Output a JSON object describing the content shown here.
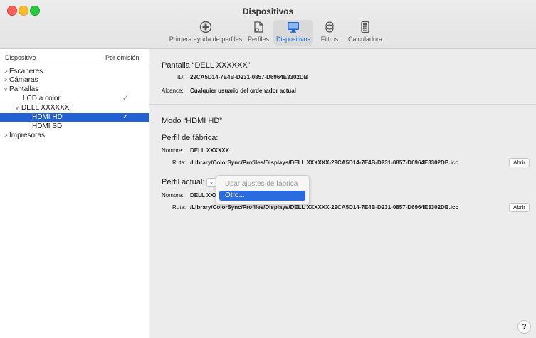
{
  "window": {
    "title": "Dispositivos"
  },
  "toolbar": {
    "items": [
      {
        "label": "Primera ayuda de perfiles",
        "icon": "first-aid-icon"
      },
      {
        "label": "Perfiles",
        "icon": "profiles-icon"
      },
      {
        "label": "Dispositivos",
        "icon": "display-icon"
      },
      {
        "label": "Filtros",
        "icon": "filters-icon"
      },
      {
        "label": "Calculadora",
        "icon": "calculator-icon"
      }
    ]
  },
  "sidebar": {
    "col_device": "Dispositivo",
    "col_default": "Por omisión",
    "rows": [
      {
        "label": "Escáneres",
        "arrow": ">"
      },
      {
        "label": "Cámaras",
        "arrow": ">"
      },
      {
        "label": "Pantallas",
        "arrow": "v"
      },
      {
        "label": "LCD a color",
        "check": "✓"
      },
      {
        "label": "DELL XXXXXX",
        "arrow": "v"
      },
      {
        "label": "HDMI HD",
        "check": "✓",
        "selected": true
      },
      {
        "label": "HDMI SD"
      },
      {
        "label": "Impresoras",
        "arrow": ">"
      }
    ]
  },
  "device": {
    "title": "Pantalla “DELL XXXXXX”",
    "id_label": "ID:",
    "id_value": "29CA5D14-7E4B-D231-0857-D6964E3302DB",
    "scope_label": "Alcance:",
    "scope_value": "Cualquier usuario del ordenador actual"
  },
  "mode": {
    "title": "Modo “HDMI HD”",
    "factory_title": "Perfil de fábrica:",
    "name_label": "Nombre:",
    "factory_name": "DELL XXXXXX",
    "path_label": "Ruta:",
    "factory_path": "/Library/ColorSync/Profiles/Displays/DELL XXXXXX-29CA5D14-7E4B-D231-0857-D6964E3302DB.icc",
    "open_label": "Abrir",
    "current_title": "Perfil actual:",
    "current_name": "DELL XXX",
    "current_path": "/Library/ColorSync/Profiles/Displays/DELL XXXXXX-29CA5D14-7E4B-D231-0857-D6964E3302DB.icc",
    "popup_chevron": "⌄"
  },
  "menu": {
    "items": [
      {
        "label": "Usar ajustes de fábrica",
        "disabled": true
      },
      {
        "label": "Otro...",
        "highlighted": true
      }
    ]
  },
  "help": {
    "label": "?"
  },
  "colors": {
    "accent": "#2261d4",
    "highlight": "#2a6be0"
  }
}
